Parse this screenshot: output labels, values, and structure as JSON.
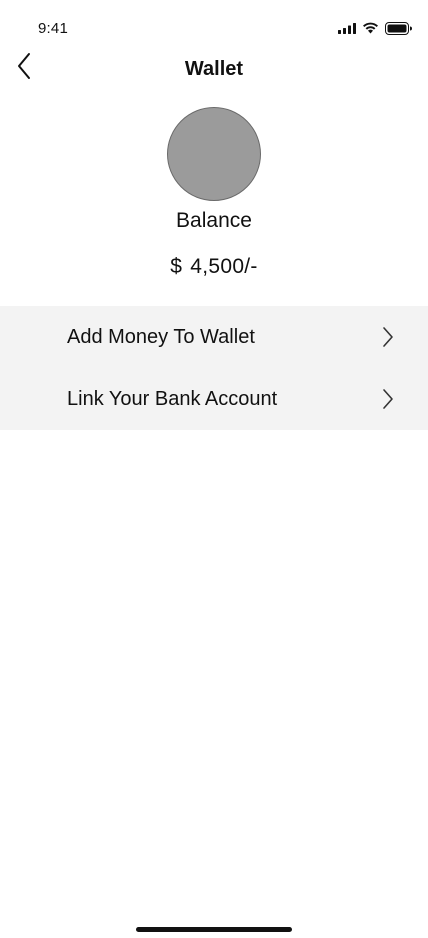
{
  "status_bar": {
    "time": "9:41",
    "icons": [
      "cellular-signal-icon",
      "wifi-icon",
      "battery-icon"
    ]
  },
  "nav": {
    "title": "Wallet",
    "back_icon": "chevron-left-icon"
  },
  "profile": {
    "avatar_color": "#9b9b9b"
  },
  "balance": {
    "label": "Balance",
    "currency": "$",
    "amount": "4,500/-"
  },
  "menu": {
    "items": [
      {
        "label": "Add Money To Wallet",
        "icon": "chevron-right-icon"
      },
      {
        "label": "Link Your Bank Account",
        "icon": "chevron-right-icon"
      }
    ],
    "background": "#f3f3f3"
  },
  "colors": {
    "background": "#ffffff",
    "text": "#111111",
    "avatar": "#9b9b9b"
  }
}
